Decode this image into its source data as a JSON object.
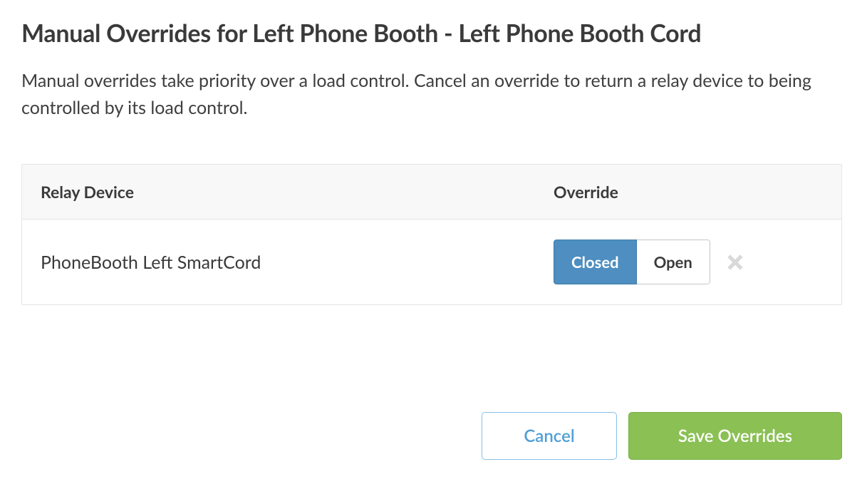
{
  "dialog": {
    "title": "Manual Overrides for Left Phone Booth - Left Phone Booth Cord",
    "description": "Manual overrides take priority over a load control. Cancel an override to return a relay device to being controlled by its load control."
  },
  "table": {
    "headers": {
      "device": "Relay Device",
      "override": "Override"
    },
    "rows": [
      {
        "device": "PhoneBooth Left SmartCord",
        "closed_label": "Closed",
        "open_label": "Open",
        "active": "closed"
      }
    ]
  },
  "footer": {
    "cancel": "Cancel",
    "save": "Save Overrides"
  },
  "colors": {
    "active_toggle": "#4e8ec0",
    "save_button": "#8ac054",
    "cancel_text": "#4f9fd6"
  }
}
